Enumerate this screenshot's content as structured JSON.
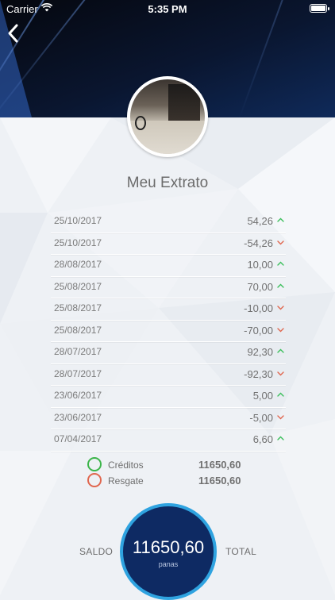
{
  "status_bar": {
    "carrier": "Carrier",
    "time": "5:35 PM"
  },
  "page": {
    "title": "Meu Extrato"
  },
  "transactions": [
    {
      "date": "25/10/2017",
      "value": "54,26",
      "direction": "up"
    },
    {
      "date": "25/10/2017",
      "value": "-54,26",
      "direction": "down"
    },
    {
      "date": "28/08/2017",
      "value": "10,00",
      "direction": "up"
    },
    {
      "date": "25/08/2017",
      "value": "70,00",
      "direction": "up"
    },
    {
      "date": "25/08/2017",
      "value": "-10,00",
      "direction": "down"
    },
    {
      "date": "25/08/2017",
      "value": "-70,00",
      "direction": "down"
    },
    {
      "date": "28/07/2017",
      "value": "92,30",
      "direction": "up"
    },
    {
      "date": "28/07/2017",
      "value": "-92,30",
      "direction": "down"
    },
    {
      "date": "23/06/2017",
      "value": "5,00",
      "direction": "up"
    },
    {
      "date": "23/06/2017",
      "value": "-5,00",
      "direction": "down"
    },
    {
      "date": "07/04/2017",
      "value": "6,60",
      "direction": "up"
    }
  ],
  "legend": {
    "credits": {
      "label": "Créditos",
      "amount": "11650,60"
    },
    "redeem": {
      "label": "Resgate",
      "amount": "11650,60"
    }
  },
  "summary": {
    "left_label": "SALDO",
    "right_label": "TOTAL",
    "balance": "11650,60",
    "unit": "panas"
  },
  "colors": {
    "up_arrow": "#3cbf5c",
    "down_arrow": "#e0674f",
    "credit_ring": "#3cb54a",
    "redeem_ring": "#e0674f",
    "balance_fill": "#0e2a63",
    "balance_border": "#2fa3e0"
  },
  "icons": {
    "back": "chevron-left-icon",
    "up": "chevron-up-icon",
    "down": "chevron-down-icon"
  }
}
